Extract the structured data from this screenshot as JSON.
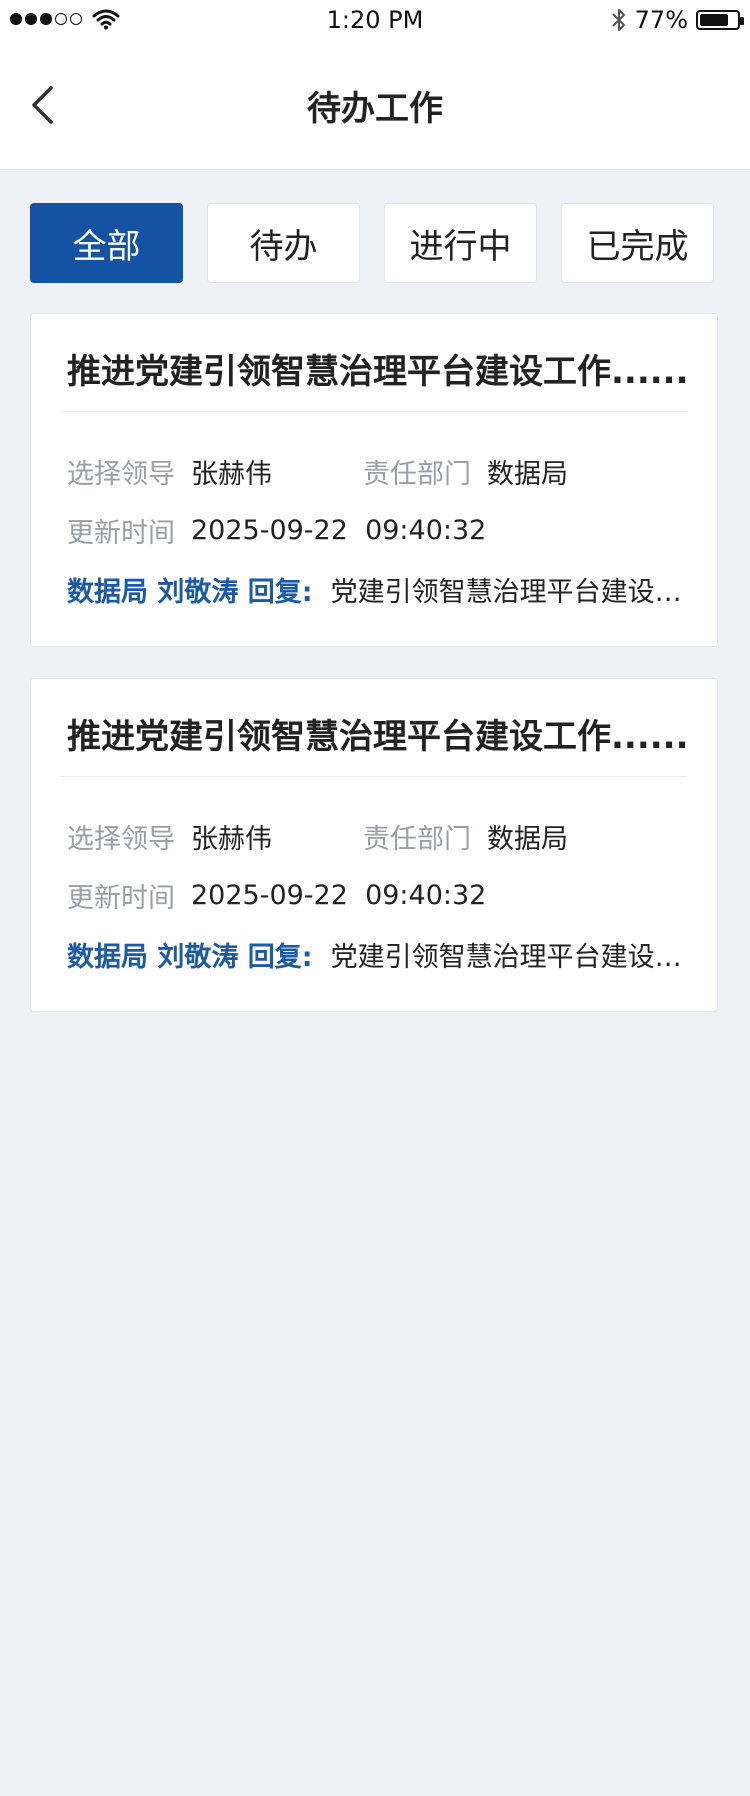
{
  "status_bar": {
    "time": "1:20 PM",
    "battery_percent": "77%",
    "battery_level": 0.77
  },
  "nav": {
    "title": "待办工作"
  },
  "tabs": [
    {
      "label": "全部",
      "active": true
    },
    {
      "label": "待办",
      "active": false
    },
    {
      "label": "进行中",
      "active": false
    },
    {
      "label": "已完成",
      "active": false
    }
  ],
  "cards": [
    {
      "title": "推进党建引领智慧治理平台建设工作......",
      "leader_label": "选择领导",
      "leader_value": "张赫伟",
      "dept_label": "责任部门",
      "dept_value": "数据局",
      "time_label": "更新时间",
      "time_value": "2025-09-22  09:40:32",
      "reply_who": "数据局 刘敬涛 回复:",
      "reply_text": "党建引领智慧治理平台建设工作"
    },
    {
      "title": "推进党建引领智慧治理平台建设工作......",
      "leader_label": "选择领导",
      "leader_value": "张赫伟",
      "dept_label": "责任部门",
      "dept_value": "数据局",
      "time_label": "更新时间",
      "time_value": "2025-09-22  09:40:32",
      "reply_who": "数据局 刘敬涛 回复:",
      "reply_text": "党建引领智慧治理平台建设工作"
    }
  ],
  "colors": {
    "accent": "#1452a3",
    "reply_blue": "#1a5aa8",
    "background": "#eef2f6"
  }
}
